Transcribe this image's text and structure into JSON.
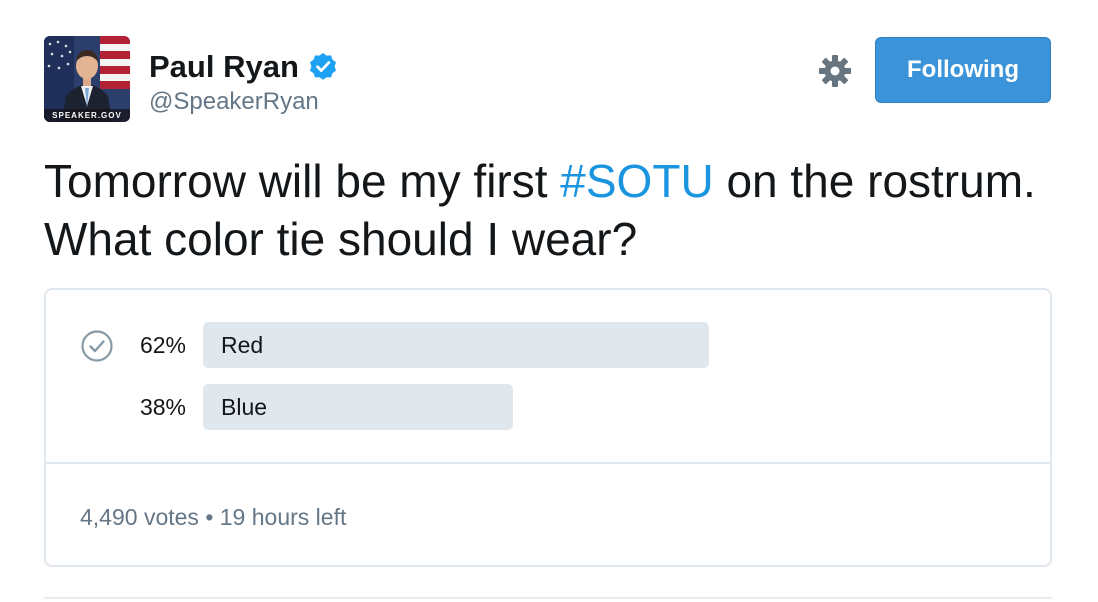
{
  "user": {
    "display_name": "Paul Ryan",
    "handle": "@SpeakerRyan",
    "avatar_caption": "SPEAKER.GOV",
    "verified": true
  },
  "actions": {
    "follow_label": "Following",
    "settings_icon": "gear-icon"
  },
  "tweet": {
    "text_before": "Tomorrow will be my first ",
    "hashtag": "#SOTU",
    "text_after": " on the rostrum. What color tie should I wear?"
  },
  "poll": {
    "options": [
      {
        "percent_label": "62%",
        "label": "Red",
        "percent": 62,
        "selected": true
      },
      {
        "percent_label": "38%",
        "label": "Blue",
        "percent": 38,
        "selected": false
      }
    ],
    "votes": "4,490 votes",
    "separator": "•",
    "time_left": "19 hours left"
  },
  "colors": {
    "link": "#1b95e0",
    "follow_button": "#3b94d9",
    "verified_badge": "#1da1f2",
    "poll_bar": "#e1e8ed",
    "secondary_text": "#657786"
  }
}
